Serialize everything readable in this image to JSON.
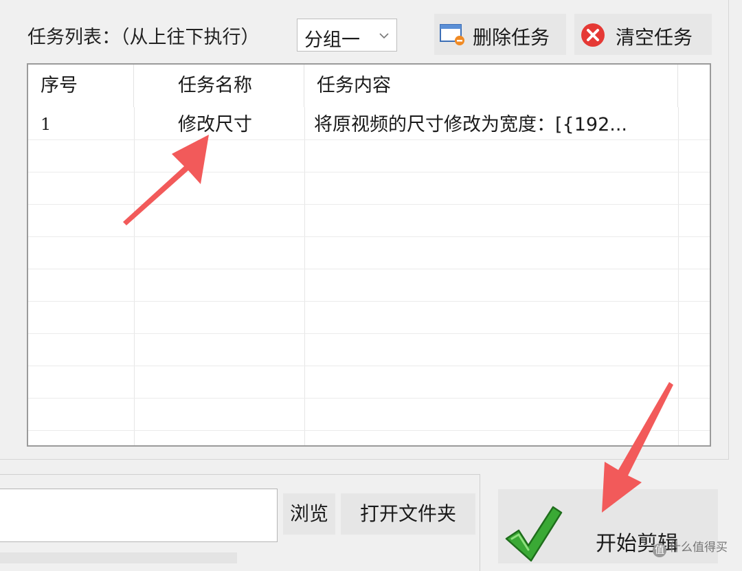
{
  "toolbar": {
    "list_label": "任务列表：（从上往下执行）",
    "group_select": {
      "selected": "分组一"
    },
    "delete_label": "删除任务",
    "clear_label": "清空任务"
  },
  "task_table": {
    "columns": [
      "序号",
      "任务名称",
      "任务内容"
    ],
    "rows": [
      {
        "index": "1",
        "name": "修改尺寸",
        "content": "将原视频的尺寸修改为宽度：[{192..."
      }
    ]
  },
  "output": {
    "path_value": "",
    "browse_label": "浏览",
    "open_folder_label": "打开文件夹"
  },
  "start": {
    "label": "开始剪辑"
  },
  "watermark": {
    "text": "什么值得买"
  },
  "colors": {
    "annotation_arrow": "#f25a5a",
    "clear_icon": "#e53935",
    "check_icon": "#3aa935"
  }
}
